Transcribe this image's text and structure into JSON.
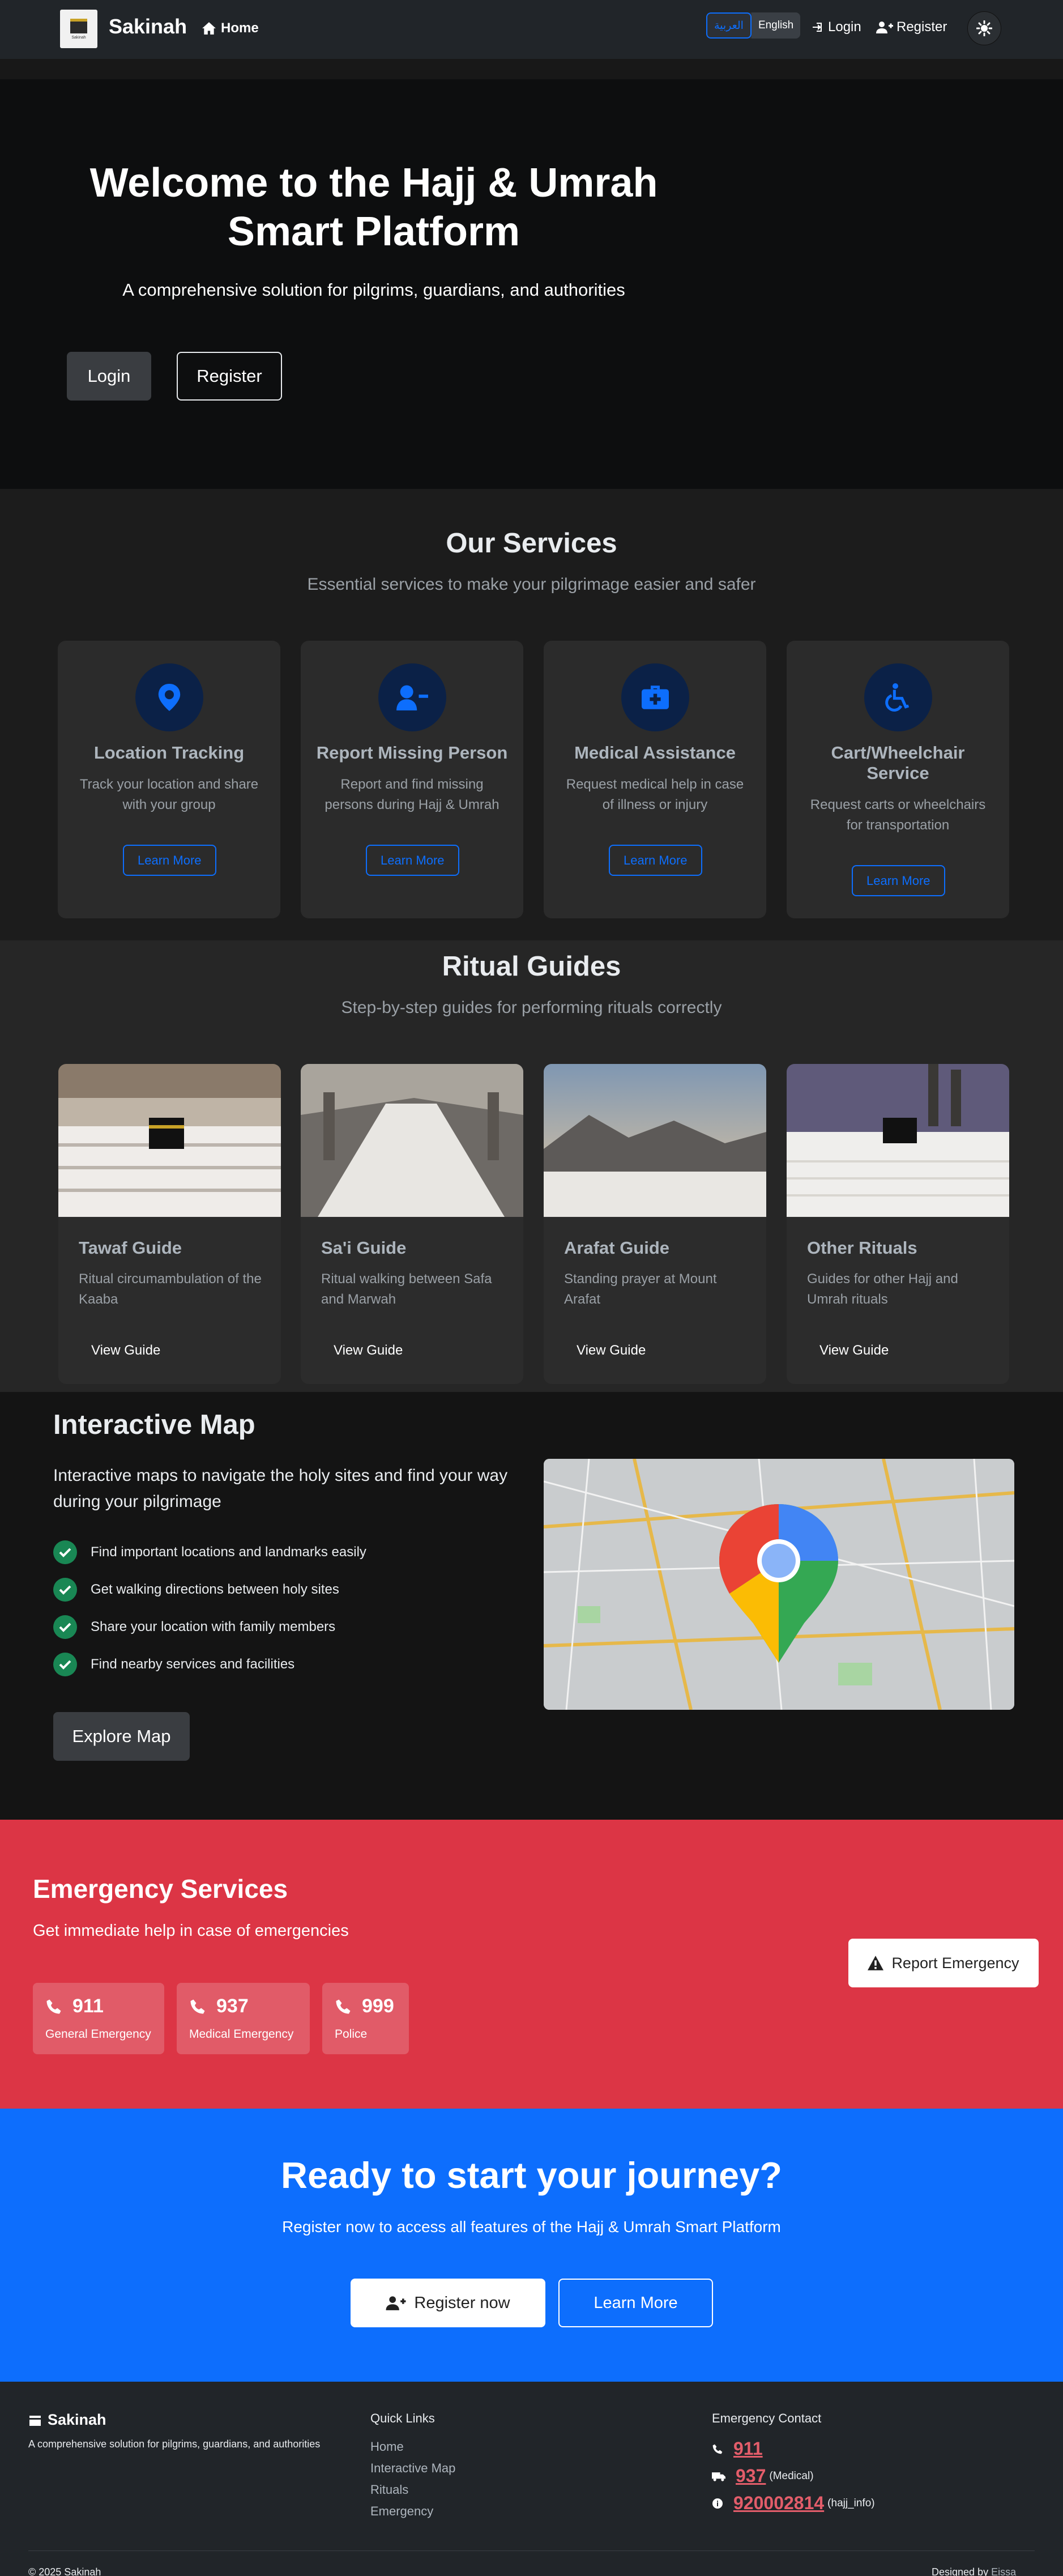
{
  "nav": {
    "brand": "Sakinah",
    "home": "Home",
    "lang_ar": "العربية",
    "lang_en": "English",
    "login": "Login",
    "register": "Register"
  },
  "hero": {
    "title": "Welcome to the Hajj & Umrah Smart Platform",
    "subtitle": "A comprehensive solution for pilgrims, guardians, and authorities",
    "login": "Login",
    "register": "Register"
  },
  "services": {
    "title": "Our Services",
    "subtitle": "Essential services to make your pilgrimage easier and safer",
    "items": [
      {
        "title": "Location Tracking",
        "desc": "Track your location and share with your group",
        "button": "Learn More",
        "icon": "location-pin-icon"
      },
      {
        "title": "Report Missing Person",
        "desc": "Report and find missing persons during Hajj & Umrah",
        "button": "Learn More",
        "icon": "user-minus-icon"
      },
      {
        "title": "Medical Assistance",
        "desc": "Request medical help in case of illness or injury",
        "button": "Learn More",
        "icon": "medical-kit-icon"
      },
      {
        "title": "Cart/Wheelchair Service",
        "desc": "Request carts or wheelchairs for transportation",
        "button": "Learn More",
        "icon": "wheelchair-icon"
      }
    ]
  },
  "rituals": {
    "title": "Ritual Guides",
    "subtitle": "Step-by-step guides for performing rituals correctly",
    "items": [
      {
        "title": "Tawaf Guide",
        "desc": "Ritual circumambulation of the Kaaba",
        "button": "View Guide"
      },
      {
        "title": "Sa'i Guide",
        "desc": "Ritual walking between Safa and Marwah",
        "button": "View Guide"
      },
      {
        "title": "Arafat Guide",
        "desc": "Standing prayer at Mount Arafat",
        "button": "View Guide"
      },
      {
        "title": "Other Rituals",
        "desc": "Guides for other Hajj and Umrah rituals",
        "button": "View Guide"
      }
    ]
  },
  "map": {
    "title": "Interactive Map",
    "lead": "Interactive maps to navigate the holy sites and find your way during your pilgrimage",
    "features": [
      "Find important locations and landmarks easily",
      "Get walking directions between holy sites",
      "Share your location with family members",
      "Find nearby services and facilities"
    ],
    "button": "Explore Map"
  },
  "emergency": {
    "title": "Emergency Services",
    "subtitle": "Get immediate help in case of emergencies",
    "cards": [
      {
        "number": "911",
        "label": "General Emergency"
      },
      {
        "number": "937",
        "label": "Medical Emergency"
      },
      {
        "number": "999",
        "label": "Police"
      }
    ],
    "report": "Report Emergency"
  },
  "cta": {
    "title": "Ready to start your journey?",
    "subtitle": "Register now to access all features of the Hajj & Umrah Smart Platform",
    "register": "Register now",
    "learn": "Learn More"
  },
  "footer": {
    "brand": "Sakinah",
    "desc": "A comprehensive solution for pilgrims, guardians, and authorities",
    "quick_links_title": "Quick Links",
    "quick_links": [
      "Home",
      "Interactive Map",
      "Rituals",
      "Emergency"
    ],
    "emergency_title": "Emergency Contact",
    "contacts": [
      {
        "number": "911",
        "note": ""
      },
      {
        "number": "937",
        "note": "(Medical)"
      },
      {
        "number": "920002814",
        "note": "(hajj_info)"
      }
    ],
    "copyright": "© 2025 Sakinah",
    "designed_by": "Designed by",
    "designer": "Eissa ALqumaie"
  },
  "colors": {
    "primary": "#0d6efd",
    "danger": "#dc3545",
    "success": "#198754",
    "dark": "#212529"
  }
}
